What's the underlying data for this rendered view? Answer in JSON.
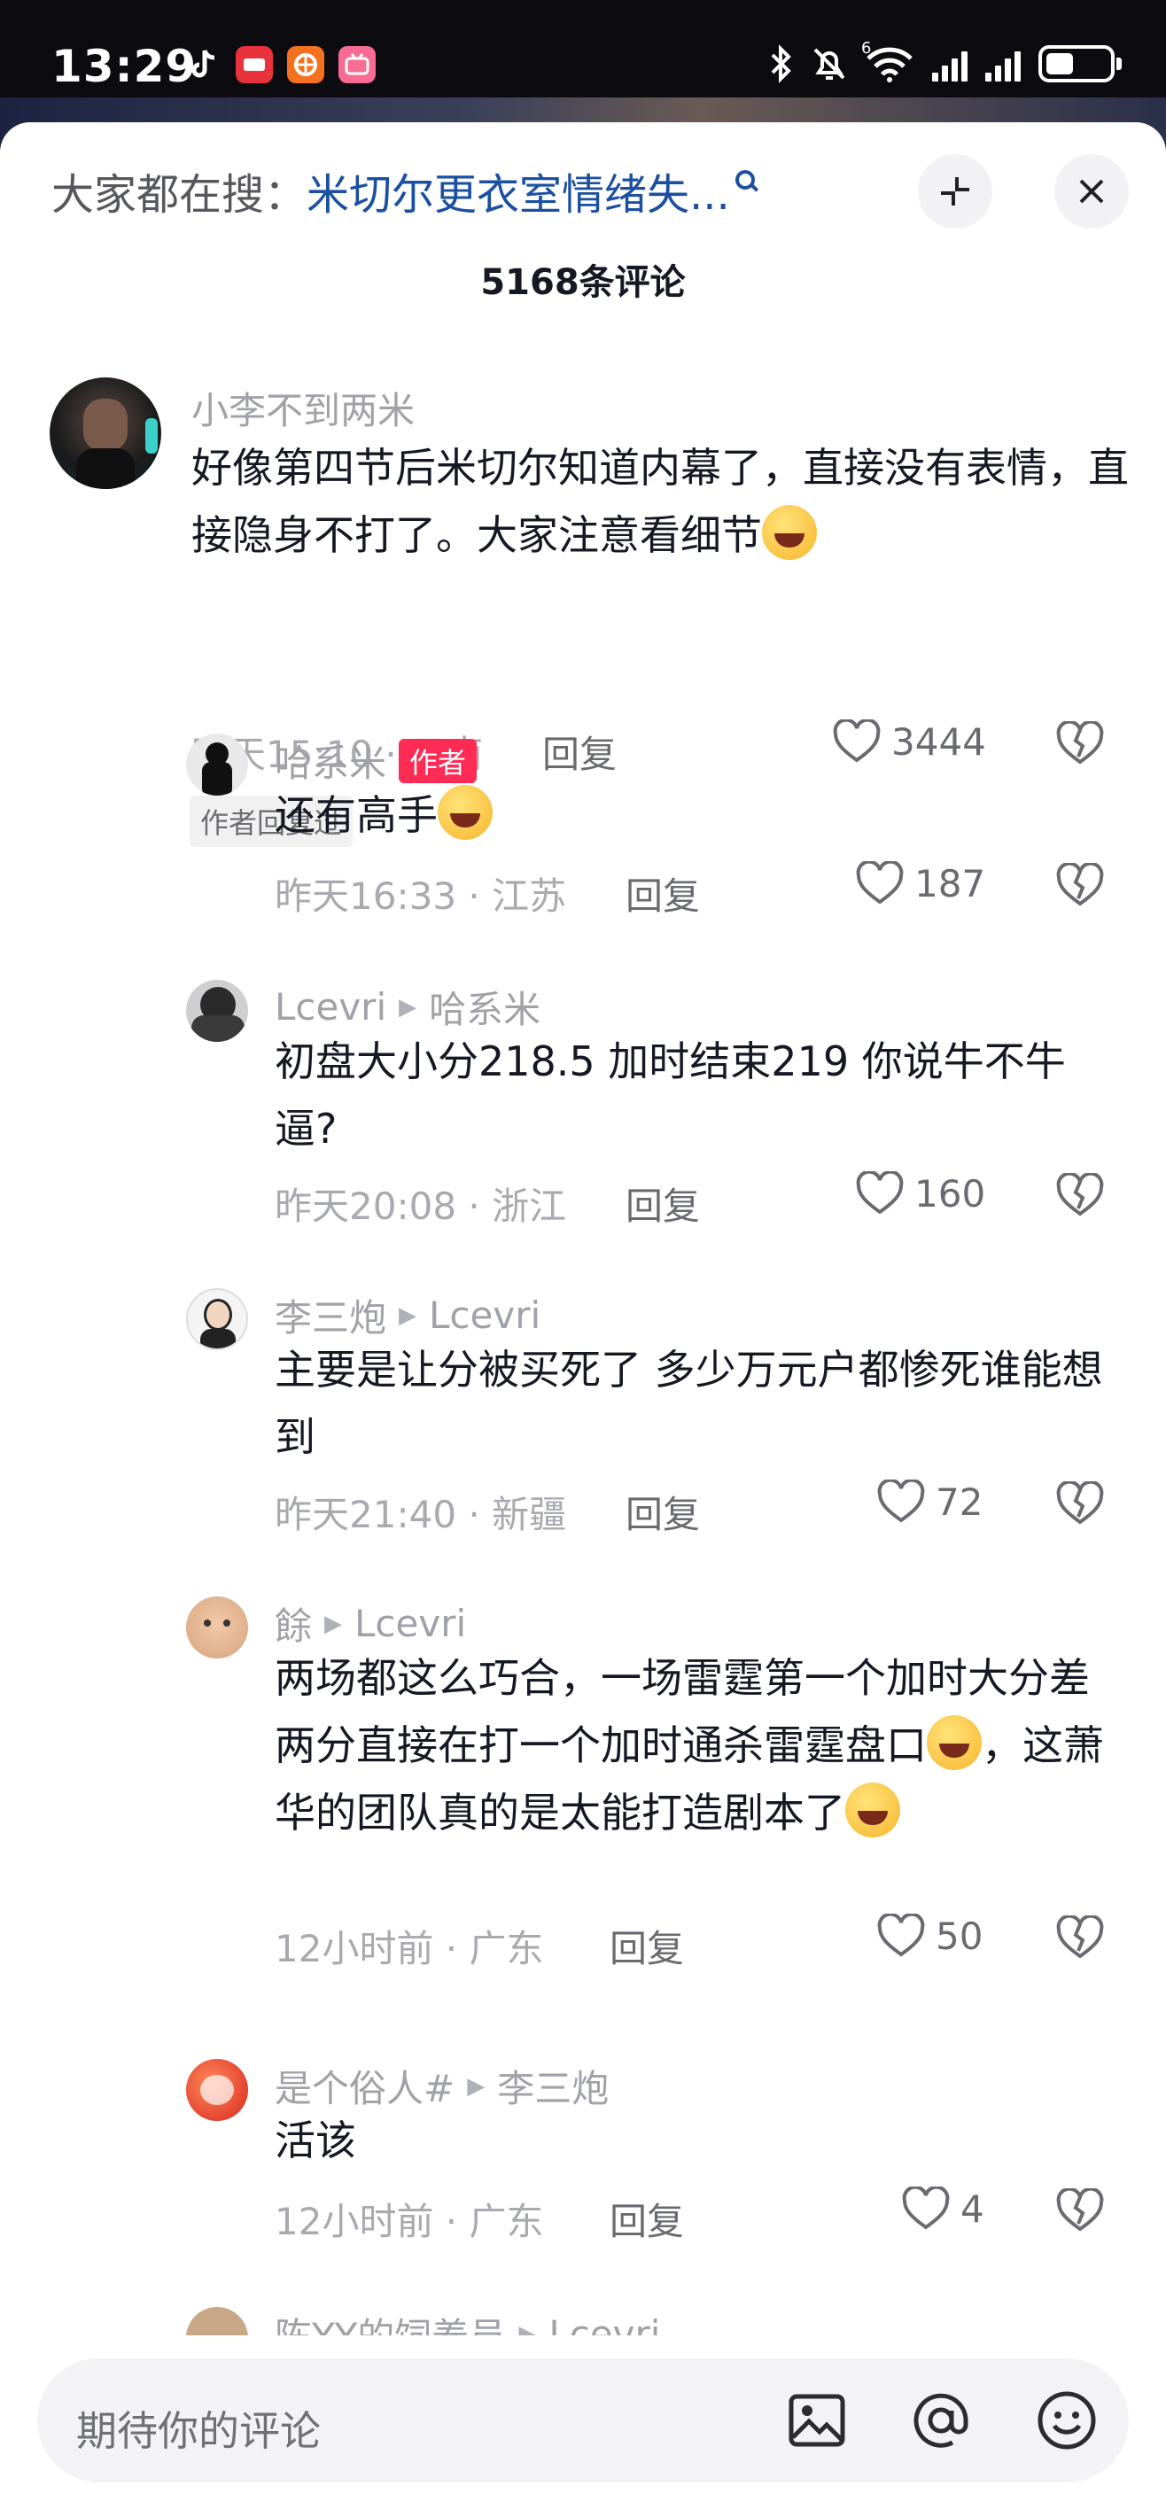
{
  "status_bar": {
    "time": "13:29",
    "apps": [
      "tiktok-icon",
      "toutiao-icon",
      "app-orange-icon",
      "bilibili-icon"
    ],
    "icons": [
      "bluetooth-icon",
      "mute-icon",
      "wifi-icon",
      "signal-icon",
      "signal-icon",
      "battery-icon"
    ],
    "wifi_badge": "6",
    "battery_level": 0.38
  },
  "header": {
    "search_prefix": "大家都在搜：",
    "search_link": "米切尔更衣室情绪失...",
    "comment_count_title": "5168条评论"
  },
  "comments": [
    {
      "name": "小李不到两米",
      "text": "好像第四节后米切尔知道内幕了，直接没有表情，直接隐身不打了。大家注意看细节",
      "emoji": "laugh-cry",
      "time": "昨天15:10",
      "location": "云南",
      "reply_label": "回复",
      "likes": "3444",
      "chip": "作者回复过"
    }
  ],
  "replies": [
    {
      "name": "哈系米",
      "badge": "作者",
      "text": "还有高手",
      "emoji": "smile",
      "time": "昨天16:33",
      "location": "江苏",
      "reply_label": "回复",
      "likes": "187"
    },
    {
      "name": "Lcevri",
      "reply_to": "哈系米",
      "text": "初盘大小分218.5 加时结束219 你说牛不牛逼?",
      "time": "昨天20:08",
      "location": "浙江",
      "reply_label": "回复",
      "likes": "160"
    },
    {
      "name": "李三炮",
      "reply_to": "Lcevri",
      "text": "主要是让分被买死了 多少万元户都惨死谁能想到",
      "time": "昨天21:40",
      "location": "新疆",
      "reply_label": "回复",
      "likes": "72"
    },
    {
      "name": "餘",
      "reply_to": "Lcevri",
      "text_a": "两场都这么巧合，一场雷霆第一个加时大分差两分直接在打一个加时通杀雷霆盘口",
      "text_b": "，这萧华的团队真的是太能打造剧本了",
      "emoji": "crying",
      "time": "12小时前",
      "location": "广东",
      "reply_label": "回复",
      "likes": "50"
    },
    {
      "name": "是个俗人#",
      "reply_to": "李三炮",
      "text": "活该",
      "time": "12小时前",
      "location": "广东",
      "reply_label": "回复",
      "likes": "4"
    },
    {
      "name": "陈YY的饲养员",
      "reply_to": "Lcevri"
    }
  ],
  "input": {
    "placeholder": "期待你的评论",
    "icons": [
      "image-icon",
      "at-icon",
      "emoji-icon"
    ]
  },
  "colors": {
    "accent_red": "#fe2c55",
    "link_blue": "#1b4fa0"
  }
}
